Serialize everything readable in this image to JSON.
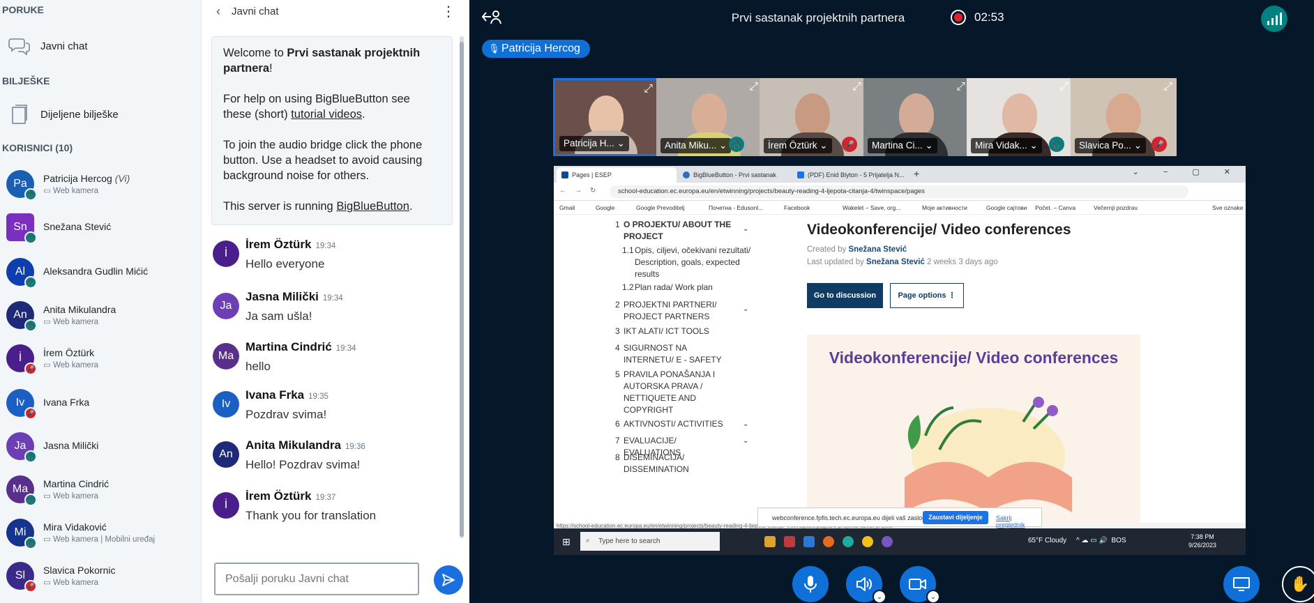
{
  "sidebar": {
    "messages_title": "PORUKE",
    "public_chat": "Javni chat",
    "notes_title": "BILJEŠKE",
    "shared_notes": "Dijeljene bilješke",
    "users_title": "KORISNICI (10)",
    "users": [
      {
        "initials": "Pa",
        "name": "Patricija Hercog",
        "role": "(Vi)",
        "sub": "Web kamera",
        "color": "#1a5fb4",
        "badge": "headset",
        "badge_color": "#008081"
      },
      {
        "initials": "Sn",
        "name": "Snežana Stević",
        "role": "",
        "sub": "",
        "color": "#7b2fbf",
        "badge": "headset",
        "badge_color": "#008081"
      },
      {
        "initials": "Al",
        "name": "Aleksandra Gudlin Mićić",
        "role": "",
        "sub": "",
        "color": "#0f3fae",
        "badge": "headset",
        "badge_color": "#008081"
      },
      {
        "initials": "An",
        "name": "Anita Mikulandra",
        "role": "",
        "sub": "Web kamera",
        "color": "#1e2a78",
        "badge": "headset",
        "badge_color": "#008081"
      },
      {
        "initials": "İ",
        "name": "İrem Öztürk",
        "role": "",
        "sub": "Web kamera",
        "color": "#4a1f8c",
        "badge": "muted",
        "badge_color": "#d1242f"
      },
      {
        "initials": "Iv",
        "name": "Ivana Frka",
        "role": "",
        "sub": "",
        "color": "#1b5fc4",
        "badge": "muted",
        "badge_color": "#d1242f"
      },
      {
        "initials": "Ja",
        "name": "Jasna Milički",
        "role": "",
        "sub": "",
        "color": "#6c3fb5",
        "badge": "headset",
        "badge_color": "#008081"
      },
      {
        "initials": "Ma",
        "name": "Martina Cindrić",
        "role": "",
        "sub": "Web kamera",
        "color": "#5a2f8c",
        "badge": "headset",
        "badge_color": "#008081"
      },
      {
        "initials": "Mi",
        "name": "Mira Vidaković",
        "role": "",
        "sub": "Web kamera | Mobilni uređaj",
        "color": "#16348f",
        "badge": "headset",
        "badge_color": "#008081"
      },
      {
        "initials": "Sl",
        "name": "Slavica Pokornic",
        "role": "",
        "sub": "Web kamera",
        "color": "#3b2a8a",
        "badge": "muted",
        "badge_color": "#d1242f"
      }
    ]
  },
  "chat": {
    "title": "Javni chat",
    "welcome_1a": "Welcome to ",
    "welcome_1b": "Prvi sastanak projektnih partnera",
    "welcome_1c": "!",
    "welcome_2a": "For help on using BigBlueButton see these (short) ",
    "welcome_2b": "tutorial videos",
    "welcome_2c": ".",
    "welcome_3": "To join the audio bridge click the phone button. Use a headset to avoid causing background noise for others.",
    "welcome_4a": "This server is running ",
    "welcome_4b": "BigBlueButton",
    "welcome_4c": ".",
    "messages": [
      {
        "initials": "İ",
        "name": "İrem Öztürk",
        "time": "19:34",
        "text": "Hello everyone",
        "color": "#4a1f8c"
      },
      {
        "initials": "Ja",
        "name": "Jasna Milički",
        "time": "19:34",
        "text": "Ja sam ušla!",
        "color": "#6c3fb5"
      },
      {
        "initials": "Ma",
        "name": "Martina Cindrić",
        "time": "19:34",
        "text": "hello",
        "color": "#5a2f8c"
      },
      {
        "initials": "Iv",
        "name": "Ivana Frka",
        "time": "19:35",
        "text": "Pozdrav svima!",
        "color": "#1b5fc4"
      },
      {
        "initials": "An",
        "name": "Anita Mikulandra",
        "time": "19:36",
        "text": "Hello! Pozdrav svima!",
        "color": "#1e2a78"
      },
      {
        "initials": "İ",
        "name": "İrem Öztürk",
        "time": "19:37",
        "text": "Thank you for translation",
        "color": "#4a1f8c"
      }
    ],
    "input_placeholder": "Pošalji poruku Javni chat"
  },
  "stage": {
    "meeting_title": "Prvi sastanak projektnih partnera",
    "rec_time": "02:53",
    "talker": "Patricija Hercog",
    "videos": [
      {
        "name": "Patricija H...",
        "mic": "none",
        "bg": "#6b4f4a",
        "skin": "#e8c2a8",
        "shirt": "#c9b8b0"
      },
      {
        "name": "Anita Miku...",
        "mic": "headset",
        "bg": "#b0aaa6",
        "skin": "#d9ae96",
        "shirt": "#d7d27a"
      },
      {
        "name": "İrem Öztürk",
        "mic": "muted",
        "bg": "#c7bfb6",
        "skin": "#c99a82",
        "shirt": "#5a4a45"
      },
      {
        "name": "Martina Ci...",
        "mic": "none",
        "bg": "#7a7f82",
        "skin": "#d4ab96",
        "shirt": "#2e2f33"
      },
      {
        "name": "Mira Vidak...",
        "mic": "headset",
        "bg": "#e6e2df",
        "skin": "#e1b8a4",
        "shirt": "#3a2b2b"
      },
      {
        "name": "Slavica Po...",
        "mic": "muted",
        "bg": "#cfc3b5",
        "skin": "#d9a98f",
        "shirt": "#4c3a35"
      }
    ]
  },
  "share": {
    "tabs": [
      "Pages | ESEP",
      "BigBlueButton - Prvi sastanak",
      "(PDF) Enid Blyton - 5 Prijatelja N..."
    ],
    "url": "school-education.ec.europa.eu/en/etwinning/projects/beauty-reading-4-ljepota-citanja-4/twinspace/pages",
    "bookmarks": [
      "Gmail",
      "Google",
      "Google Prevoditelj",
      "Почетна - Edusonl...",
      "Facebook",
      "Wakelet – Save, org...",
      "Моје активности",
      "Google сајтови",
      "Počet. – Canva",
      "Večernji pozdrav."
    ],
    "bookmarks_right": "Sve oznake",
    "toc": [
      {
        "n": "1",
        "t": "O PROJEKTU/ ABOUT THE PROJECT",
        "bold": true,
        "chev": true
      },
      {
        "n": "1.1",
        "t": "Opis, ciljevi, očekivani rezultati/ Description, goals, expected results",
        "sub": true
      },
      {
        "n": "1.2",
        "t": "Plan rada/ Work plan",
        "sub": true
      },
      {
        "n": "2",
        "t": "PROJEKTNI PARTNERI/ PROJECT PARTNERS",
        "chev": true
      },
      {
        "n": "3",
        "t": "IKT ALATI/ ICT TOOLS"
      },
      {
        "n": "4",
        "t": "SIGURNOST NA INTERNETU/ E - SAFETY"
      },
      {
        "n": "5",
        "t": "PRAVILA PONAŠANJA I AUTORSKA PRAVA / NETTIQUETE AND COPYRIGHT"
      },
      {
        "n": "6",
        "t": "AKTIVNOSTI/ ACTIVITIES",
        "chev": true
      },
      {
        "n": "7",
        "t": "EVALUACIJE/ EVALUATIONS",
        "chev": true
      },
      {
        "n": "8",
        "t": "DISEMINACIJA/ DISSEMINATION"
      }
    ],
    "page_title": "Videokonferencije/ Video conferences",
    "created_label": "Created by ",
    "created_by": "Snežana Stević",
    "updated_label": "Last updated by ",
    "updated_by": "Snežana Stević",
    "updated_ago": " 2 weeks 3 days ago",
    "btn_discussion": "Go to discussion",
    "btn_options": "Page options",
    "banner_title": "Videokonferencije/ Video conferences",
    "status_url": "https://school-education.ec.europa.eu/en/etwinning/projects/beauty-reading-4-ljepota-citanja-4/twinspace/pages/o-projektu-about-project",
    "notice_text": "webconference.fpfis.tech.ec.europa.eu dijeli vaš zaslon.",
    "notice_stop": "Zaustavi dijeljenje",
    "notice_hide": "Sakrij preglednik",
    "taskbar_search": "Type here to search",
    "weather": "65°F  Cloudy",
    "lang": "BOS",
    "clock_time": "7:38 PM",
    "clock_date": "9/26/2023"
  }
}
